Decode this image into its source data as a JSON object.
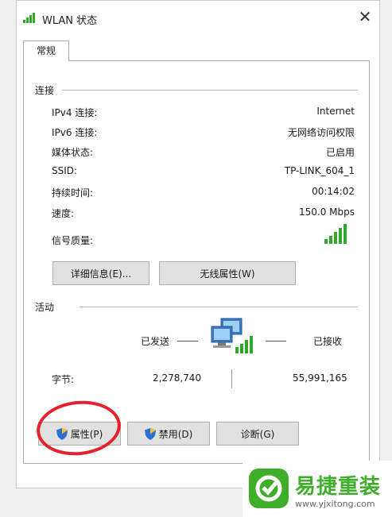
{
  "window": {
    "title": "WLAN 状态",
    "close_glyph": "✕"
  },
  "tabs": [
    {
      "label": "常规"
    }
  ],
  "connection": {
    "heading": "连接",
    "rows": [
      {
        "label": "IPv4 连接:",
        "value": "Internet"
      },
      {
        "label": "IPv6 连接:",
        "value": "无网络访问权限"
      },
      {
        "label": "媒体状态:",
        "value": "已启用"
      },
      {
        "label": "SSID:",
        "value": "TP-LINK_604_1"
      },
      {
        "label": "持续时间:",
        "value": "00:14:02"
      },
      {
        "label": "速度:",
        "value": "150.0 Mbps"
      }
    ],
    "signal_label": "信号质量:",
    "signal_icon": "signal-bars-icon",
    "buttons": {
      "details": "详细信息(E)...",
      "wireless": "无线属性(W)"
    }
  },
  "activity": {
    "heading": "活动",
    "sent_label": "已发送",
    "received_label": "已接收",
    "bytes_label": "字节:",
    "sent_bytes": "2,278,740",
    "received_bytes": "55,991,165",
    "network_icon": "network-computers-icon"
  },
  "actions": {
    "properties": "属性(P)",
    "disable": "禁用(D)",
    "diagnose": "诊断(G)"
  },
  "watermark": {
    "name": "易捷重装",
    "url": "www.yjxitong.com"
  },
  "colors": {
    "signal_green": "#2fa82a",
    "annotation_red": "#e8202b",
    "brand_green": "#3fae2a"
  }
}
